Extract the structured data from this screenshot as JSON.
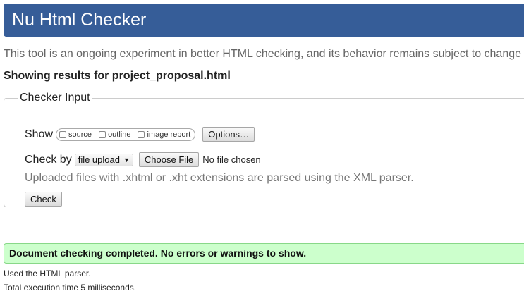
{
  "header": {
    "title": "Nu Html Checker"
  },
  "intro": {
    "text": "This tool is an ongoing experiment in better HTML checking, and its behavior remains subject to change"
  },
  "results_for": {
    "text": "Showing results for project_proposal.html"
  },
  "checker_input": {
    "legend": "Checker Input",
    "show_label": "Show",
    "show_options": [
      {
        "label": "source",
        "checked": false
      },
      {
        "label": "outline",
        "checked": false
      },
      {
        "label": "image report",
        "checked": false
      }
    ],
    "options_button": "Options…",
    "check_by_label": "Check by",
    "check_by_select": "file upload",
    "choose_file_button": "Choose File",
    "no_file_text": "No file chosen",
    "note": "Uploaded files with .xhtml or .xht extensions are parsed using the XML parser.",
    "check_button": "Check"
  },
  "result": {
    "success_message": "Document checking completed. No errors or warnings to show.",
    "parser_info": "Used the HTML parser.",
    "execution_time": "Total execution time 5 milliseconds."
  },
  "colors": {
    "header_bg": "#365d98",
    "success_bg": "#ccffcc",
    "success_border": "#88d888"
  }
}
